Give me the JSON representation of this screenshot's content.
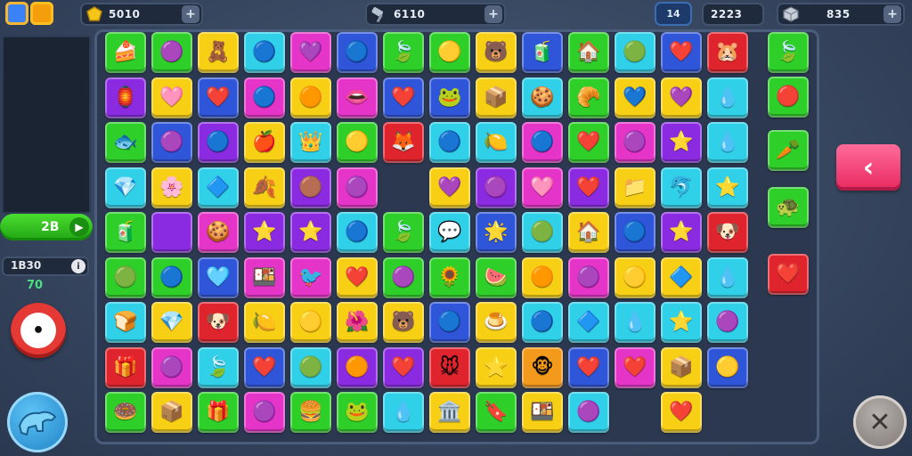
{
  "currency": {
    "coins": {
      "value": "5010",
      "plus": "+"
    },
    "tools": {
      "value": "6110",
      "plus": "+"
    },
    "level_badge": "14",
    "score": "2223",
    "gems": {
      "value": "835",
      "plus": "+"
    }
  },
  "left": {
    "score_value": "2B",
    "score_arrow": "▶",
    "moves_value": "1B30",
    "moves_info": "i",
    "moves_sub": "70",
    "timer_face": "•"
  },
  "buttons": {
    "back": "‹",
    "close": "✕"
  },
  "colors": {
    "green": "#2fcf2a",
    "yellow": "#f7cf14",
    "cyan": "#2fd0e8",
    "magenta": "#e534c8",
    "blue": "#2f55d8",
    "red": "#e0242e",
    "purple": "#8a2be2",
    "orange": "#f39a1c"
  },
  "board": {
    "rows": [
      [
        [
          "green",
          "🍰"
        ],
        [
          "green",
          "🟣"
        ],
        [
          "yellow",
          "🧸"
        ],
        [
          "cyan",
          "🔵"
        ],
        [
          "magenta",
          "💜"
        ],
        [
          "blue",
          "🔵"
        ],
        [
          "green",
          "🍃"
        ],
        [
          "green",
          "🟡"
        ],
        [
          "yellow",
          "🐻"
        ],
        [
          "blue",
          "🧃"
        ],
        [
          "green",
          "🏠"
        ],
        [
          "cyan",
          "🟢"
        ],
        [
          "blue",
          "❤️"
        ],
        [
          "red",
          "🐹"
        ]
      ],
      [
        [
          "purple",
          "🏮"
        ],
        [
          "yellow",
          "🩷"
        ],
        [
          "blue",
          "❤️"
        ],
        [
          "magenta",
          "🔵"
        ],
        [
          "yellow",
          "🟠"
        ],
        [
          "magenta",
          "👄"
        ],
        [
          "blue",
          "❤️"
        ],
        [
          "blue",
          "🐸"
        ],
        [
          "yellow",
          "📦"
        ],
        [
          "cyan",
          "🍪"
        ],
        [
          "green",
          "🥐"
        ],
        [
          "yellow",
          "💙"
        ],
        [
          "yellow",
          "💜"
        ],
        [
          "cyan",
          "💧"
        ]
      ],
      [
        [
          "green",
          "🐟"
        ],
        [
          "blue",
          "🟣"
        ],
        [
          "purple",
          "🔵"
        ],
        [
          "yellow",
          "🍎"
        ],
        [
          "cyan",
          "👑"
        ],
        [
          "green",
          "🟡"
        ],
        [
          "red",
          "🦊"
        ],
        [
          "cyan",
          "🔵"
        ],
        [
          "cyan",
          "🍋"
        ],
        [
          "magenta",
          "🔵"
        ],
        [
          "green",
          "❤️"
        ],
        [
          "magenta",
          "🟣"
        ],
        [
          "purple",
          "⭐"
        ],
        [
          "cyan",
          "💧"
        ]
      ],
      [
        [
          "cyan",
          "💎"
        ],
        [
          "yellow",
          "🌸"
        ],
        [
          "cyan",
          "🔷"
        ],
        [
          "yellow",
          "🍂"
        ],
        [
          "purple",
          "🟤"
        ],
        [
          "magenta",
          "🟣"
        ],
        null,
        [
          "yellow",
          "💜"
        ],
        [
          "purple",
          "🟣"
        ],
        [
          "magenta",
          "🩷"
        ],
        [
          "purple",
          "❤️"
        ],
        [
          "yellow",
          "📁"
        ],
        [
          "cyan",
          "🐬"
        ],
        [
          "cyan",
          "⭐"
        ]
      ],
      [
        [
          "green",
          "🧃"
        ],
        [
          "purple",
          ""
        ],
        [
          "magenta",
          "🍪"
        ],
        [
          "purple",
          "⭐"
        ],
        [
          "purple",
          "⭐"
        ],
        [
          "cyan",
          "🔵"
        ],
        [
          "green",
          "🍃"
        ],
        [
          "cyan",
          "💬"
        ],
        [
          "blue",
          "🌟"
        ],
        [
          "cyan",
          "🟢"
        ],
        [
          "yellow",
          "🏠"
        ],
        [
          "blue",
          "🔵"
        ],
        [
          "purple",
          "⭐"
        ],
        [
          "red",
          "🐶"
        ]
      ],
      [
        [
          "green",
          "🟢"
        ],
        [
          "green",
          "🔵"
        ],
        [
          "blue",
          "🩵"
        ],
        [
          "magenta",
          "🍱"
        ],
        [
          "magenta",
          "🐦"
        ],
        [
          "yellow",
          "❤️"
        ],
        [
          "green",
          "🟣"
        ],
        [
          "green",
          "🌻"
        ],
        [
          "green",
          "🍉"
        ],
        [
          "yellow",
          "🟠"
        ],
        [
          "magenta",
          "🟣"
        ],
        [
          "yellow",
          "🟡"
        ],
        [
          "yellow",
          "🔷"
        ],
        [
          "cyan",
          "💧"
        ]
      ],
      [
        [
          "cyan",
          "🍞"
        ],
        [
          "yellow",
          "💎"
        ],
        [
          "red",
          "🐶"
        ],
        [
          "yellow",
          "🍋"
        ],
        [
          "yellow",
          "🟡"
        ],
        [
          "yellow",
          "🌺"
        ],
        [
          "yellow",
          "🐻"
        ],
        [
          "blue",
          "🔵"
        ],
        [
          "yellow",
          "🍮"
        ],
        [
          "cyan",
          "🔵"
        ],
        [
          "cyan",
          "🔷"
        ],
        [
          "cyan",
          "💧"
        ],
        [
          "cyan",
          "⭐"
        ],
        [
          "cyan",
          "🟣"
        ]
      ],
      [
        [
          "red",
          "🎁"
        ],
        [
          "magenta",
          "🟣"
        ],
        [
          "cyan",
          "🍃"
        ],
        [
          "blue",
          "❤️"
        ],
        [
          "cyan",
          "🟢"
        ],
        [
          "purple",
          "🟠"
        ],
        [
          "purple",
          "❤️"
        ],
        [
          "red",
          "🐭"
        ],
        [
          "yellow",
          "⭐"
        ],
        [
          "orange",
          "🐵"
        ],
        [
          "blue",
          "❤️"
        ],
        [
          "magenta",
          "❤️"
        ],
        [
          "yellow",
          "📦"
        ],
        [
          "blue",
          "🟡"
        ]
      ],
      [
        [
          "green",
          "🍩"
        ],
        [
          "yellow",
          "📦"
        ],
        [
          "green",
          "🎁"
        ],
        [
          "magenta",
          "🟣"
        ],
        [
          "green",
          "🍔"
        ],
        [
          "green",
          "🐸"
        ],
        [
          "cyan",
          "💧"
        ],
        [
          "yellow",
          "🏛️"
        ],
        [
          "green",
          "🔖"
        ],
        [
          "yellow",
          "🍱"
        ],
        [
          "cyan",
          "🟣"
        ],
        null,
        [
          "yellow",
          "❤️"
        ],
        null
      ]
    ],
    "side": [
      [
        "green",
        "🍃"
      ],
      [
        "green",
        "🔴"
      ],
      [
        "green",
        "🥕"
      ],
      [
        "green",
        "🐢"
      ],
      [
        "red",
        "❤️"
      ]
    ]
  }
}
